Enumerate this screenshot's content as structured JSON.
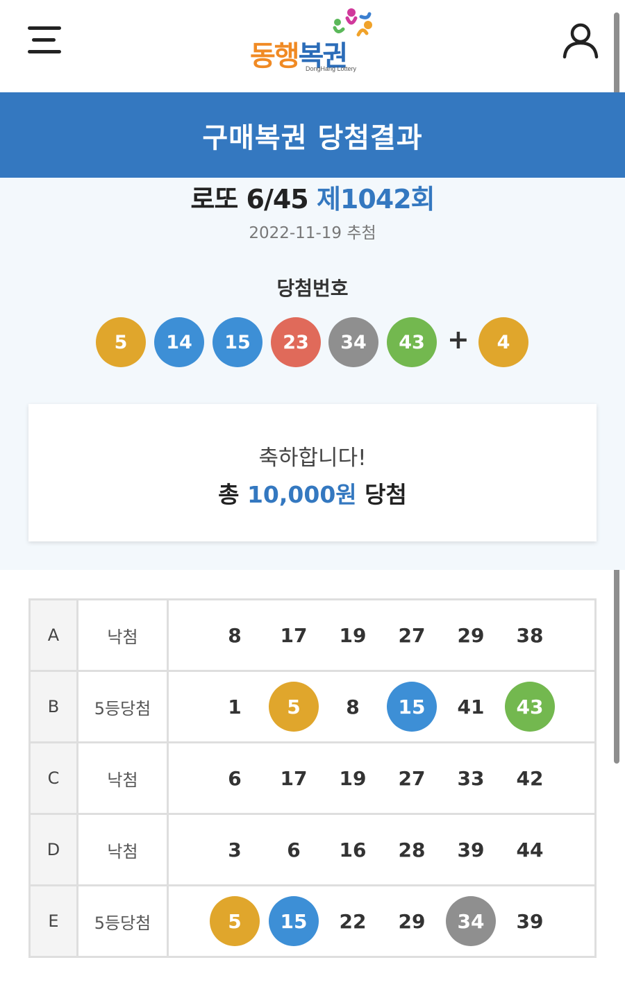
{
  "header": {
    "logo_main": "동행",
    "logo_blue": "복권",
    "logo_sub": "DongHang Lottery",
    "menu_icon": "hamburger-menu-icon",
    "user_icon": "user-profile-icon"
  },
  "banner": {
    "title": "구매복권 당첨결과"
  },
  "draw": {
    "game": "로또 6/45",
    "round": "제1042회",
    "date": "2022-11-19 추첨"
  },
  "winning": {
    "label": "당첨번호",
    "numbers": [
      {
        "n": "5",
        "color": "#e0a62c"
      },
      {
        "n": "14",
        "color": "#3d8fd6"
      },
      {
        "n": "15",
        "color": "#3d8fd6"
      },
      {
        "n": "23",
        "color": "#e06a5a"
      },
      {
        "n": "34",
        "color": "#8f8f8f"
      },
      {
        "n": "43",
        "color": "#73b84f"
      }
    ],
    "plus": "+",
    "bonus": {
      "n": "4",
      "color": "#e0a62c"
    }
  },
  "result": {
    "congrats": "축하합니다!",
    "prefix": "총 ",
    "amount": "10,000원",
    "suffix": " 당첨"
  },
  "tickets": [
    {
      "letter": "A",
      "status": "낙첨",
      "numbers": [
        {
          "n": "8"
        },
        {
          "n": "17"
        },
        {
          "n": "19"
        },
        {
          "n": "27"
        },
        {
          "n": "29"
        },
        {
          "n": "38"
        }
      ]
    },
    {
      "letter": "B",
      "status": "5등당첨",
      "numbers": [
        {
          "n": "1"
        },
        {
          "n": "5",
          "color": "#e0a62c"
        },
        {
          "n": "8"
        },
        {
          "n": "15",
          "color": "#3d8fd6"
        },
        {
          "n": "41"
        },
        {
          "n": "43",
          "color": "#73b84f"
        }
      ]
    },
    {
      "letter": "C",
      "status": "낙첨",
      "numbers": [
        {
          "n": "6"
        },
        {
          "n": "17"
        },
        {
          "n": "19"
        },
        {
          "n": "27"
        },
        {
          "n": "33"
        },
        {
          "n": "42"
        }
      ]
    },
    {
      "letter": "D",
      "status": "낙첨",
      "numbers": [
        {
          "n": "3"
        },
        {
          "n": "6"
        },
        {
          "n": "16"
        },
        {
          "n": "28"
        },
        {
          "n": "39"
        },
        {
          "n": "44"
        }
      ]
    },
    {
      "letter": "E",
      "status": "5등당첨",
      "numbers": [
        {
          "n": "5",
          "color": "#e0a62c"
        },
        {
          "n": "15",
          "color": "#3d8fd6"
        },
        {
          "n": "22"
        },
        {
          "n": "29"
        },
        {
          "n": "34",
          "color": "#8f8f8f"
        },
        {
          "n": "39"
        }
      ]
    }
  ]
}
